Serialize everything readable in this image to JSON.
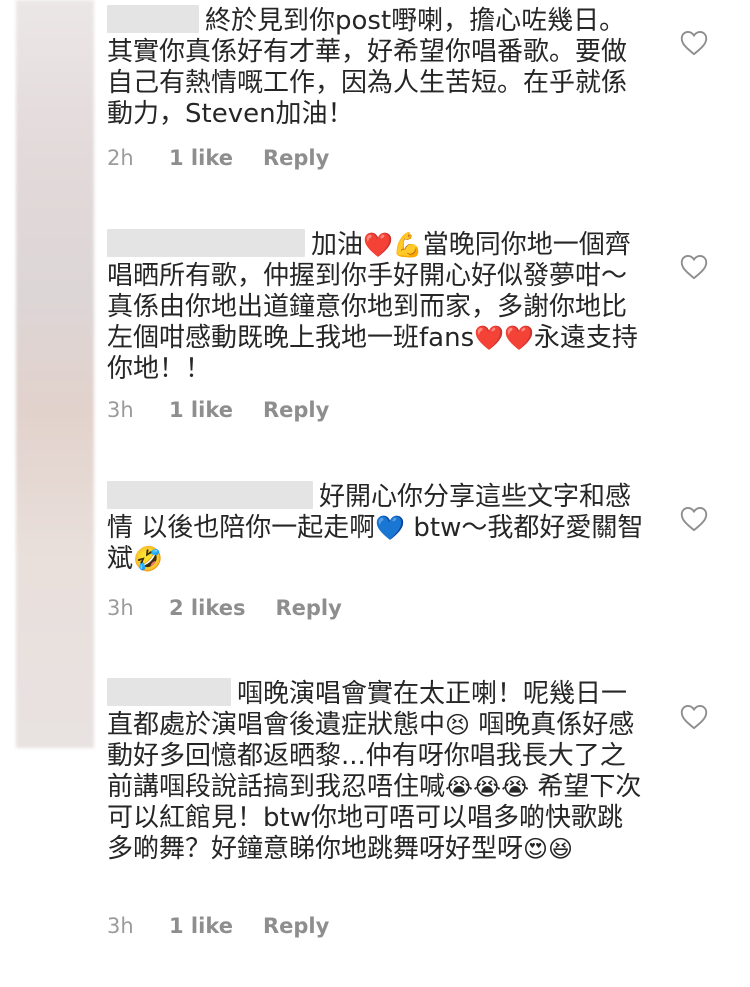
{
  "comments": [
    {
      "text": "終於見到你post嘢喇，擔心咗幾日。其實你真係好有才華，好希望你唱番歌。要做自己有熱情嘅工作，因為人生苦短。在乎就係動力，Steven加油！",
      "time": "2h",
      "likes": "1 like",
      "reply": "Reply"
    },
    {
      "text_a": "加油",
      "text_b": "當晚同你地一個齊唱晒所有歌，仲握到你手好開心好似發夢咁～真係由你地出道鐘意你地到而家，多謝你地比左個咁感動既晚上我地一班fans",
      "text_c": "永遠支持你地！！",
      "time": "3h",
      "likes": "1 like",
      "reply": "Reply"
    },
    {
      "text_a": "好開心你分享這些文字和感情 以後也陪你一起走啊",
      "text_b": " btw～我都好愛關智斌",
      "time": "3h",
      "likes": "2 likes",
      "reply": "Reply"
    },
    {
      "text_a": "啯晚演唱會實在太正喇！呢幾日一直都處於演唱會後遺症狀態中",
      "text_b": " 啯晚真係好感動好多回憶都返晒黎...仲有呀你唱我長大了之前講啯段說話搞到我忍唔住喊",
      "text_c": " 希望下次可以紅館見！btw你地可唔可以唱多啲快歌跳多啲舞？好鐘意睇你地跳舞呀好型呀",
      "time": "3h",
      "likes": "1 like",
      "reply": "Reply"
    }
  ],
  "icons": {
    "heart": "heart-outline-icon",
    "red_heart": "❤️",
    "muscle": "💪",
    "blue_heart": "💙",
    "rofl": "🤣",
    "persevere": "😣",
    "sob": "😭",
    "heart_eyes": "😍",
    "laughing": "😆"
  },
  "colors": {
    "text": "#262626",
    "meta": "#8e8e8e",
    "redaction": "#e4e4e4"
  }
}
